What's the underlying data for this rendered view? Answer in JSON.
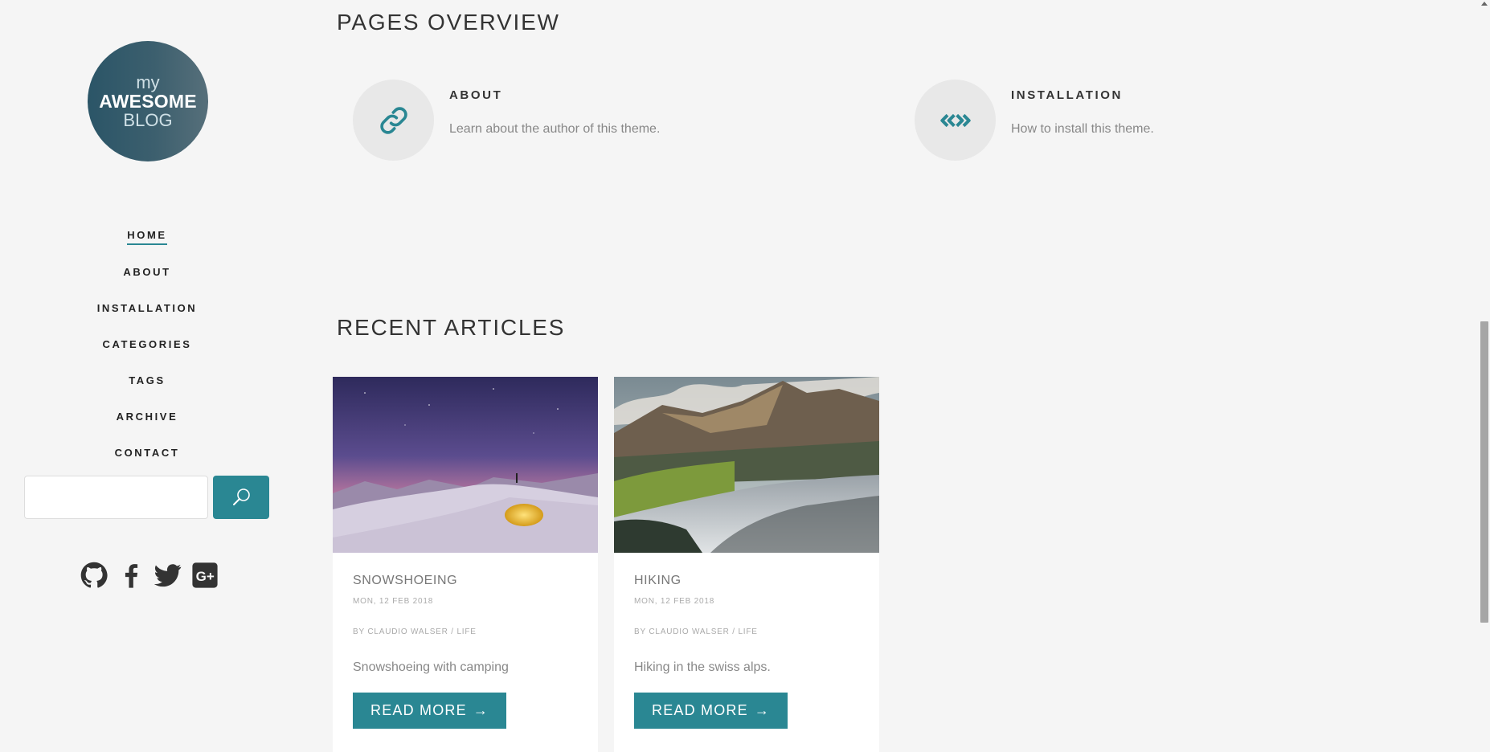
{
  "logo": {
    "line1": "my",
    "line2": "AWESOME",
    "line3": "BLOG"
  },
  "nav": {
    "items": [
      {
        "label": "HOME",
        "active": true
      },
      {
        "label": "ABOUT"
      },
      {
        "label": "INSTALLATION"
      },
      {
        "label": "CATEGORIES"
      },
      {
        "label": "TAGS"
      },
      {
        "label": "ARCHIVE"
      },
      {
        "label": "CONTACT"
      }
    ]
  },
  "search": {
    "value": "",
    "button_icon": "search-icon"
  },
  "social": {
    "icons": [
      "github-icon",
      "facebook-icon",
      "twitter-icon",
      "google-plus-icon"
    ]
  },
  "pages_overview": {
    "title": "PAGES OVERVIEW",
    "items": [
      {
        "icon": "link-icon",
        "title": "ABOUT",
        "description": "Learn about the author of this theme."
      },
      {
        "icon": "code-icon",
        "title": "INSTALLATION",
        "description": "How to install this theme."
      }
    ]
  },
  "recent_articles": {
    "title": "RECENT ARTICLES",
    "cards": [
      {
        "title": "SNOWSHOEING",
        "date": "MON, 12 FEB 2018",
        "by_prefix": "BY",
        "author": "CLAUDIO WALSER",
        "separator": "/",
        "category": "LIFE",
        "summary": "Snowshoeing with camping",
        "read_more": "READ MORE"
      },
      {
        "title": "HIKING",
        "date": "MON, 12 FEB 2018",
        "by_prefix": "BY",
        "author": "CLAUDIO WALSER",
        "separator": "/",
        "category": "LIFE",
        "summary": "Hiking in the swiss alps.",
        "read_more": "READ MORE"
      }
    ]
  },
  "colors": {
    "accent": "#2a8793",
    "logo_bg": "#2b5567",
    "page_bg": "#f5f5f5"
  }
}
